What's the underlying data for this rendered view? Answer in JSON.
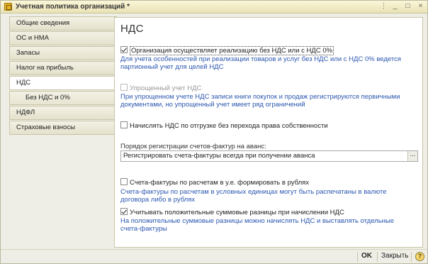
{
  "window": {
    "title": "Учетная политика организаций *",
    "controls": {
      "menu": "⋮",
      "minimize": "_",
      "maximize": "□",
      "close": "×"
    }
  },
  "sidebar": {
    "items": [
      {
        "label": "Общие сведения"
      },
      {
        "label": "ОС и НМА"
      },
      {
        "label": "Запасы"
      },
      {
        "label": "Налог на прибыль"
      },
      {
        "label": "НДС",
        "active": true
      },
      {
        "label": "Без НДС и 0%"
      },
      {
        "label": "НДФЛ"
      },
      {
        "label": "Страховые взносы"
      }
    ]
  },
  "main": {
    "title": "НДС",
    "options": [
      {
        "label": "Организация осуществляет реализацию без НДС или с НДС 0%",
        "checked": true,
        "hint": "Для учета особенностей при реализации товаров и услуг без НДС или с НДС 0% ведется партионный учет для целей НДС"
      },
      {
        "label": "Упрощенный учет НДС",
        "checked": false,
        "disabled": true,
        "hint": "При упрощенном учете НДС записи книги покупок и продаж регистрируются первичными документами, но упрощенный учет имеет ряд ограничений"
      },
      {
        "label": "Начислять НДС по отгрузке без перехода права собственности",
        "checked": false
      }
    ],
    "invoice_order": {
      "label": "Порядок регистрации счетов-фактур на аванс:",
      "value": "Регистрировать счета-фактуры всегда при получении аванса",
      "button": "..."
    },
    "options2": [
      {
        "label": "Счета-фактуры по расчетам в у.е. формировать в рублях",
        "checked": false,
        "hint": "Счета-фактуры по расчетам в условных единицах могут быть распечатаны в валюте договора либо в рублях"
      },
      {
        "label": "Учитывать положительные суммовые разницы при начислении НДС",
        "checked": true,
        "hint": "На положительные суммовые разницы можно начислять НДС и выставлять отдельные счета-фактуры"
      }
    ]
  },
  "footer": {
    "ok_label": "OK",
    "close_label": "Закрыть",
    "help_label": "?"
  }
}
